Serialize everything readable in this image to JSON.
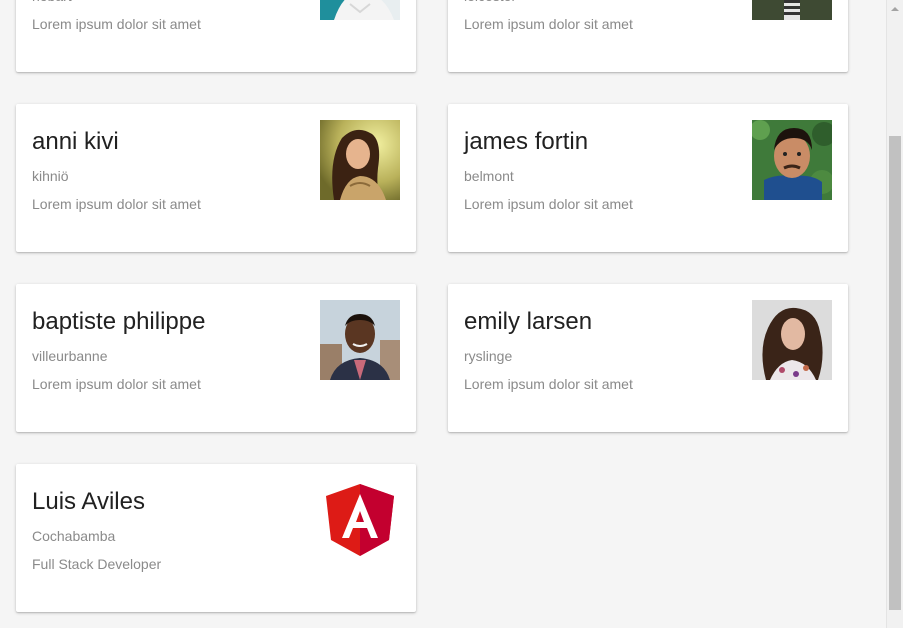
{
  "cards": [
    {
      "name": "",
      "city": "hobart",
      "description": "Lorem ipsum dolor sit amet",
      "photo": "person-photo"
    },
    {
      "name": "",
      "city": "leicester",
      "description": "Lorem ipsum dolor sit amet",
      "photo": "person-photo"
    },
    {
      "name": "anni kivi",
      "city": "kihniö",
      "description": "Lorem ipsum dolor sit amet",
      "photo": "person-photo"
    },
    {
      "name": "james fortin",
      "city": "belmont",
      "description": "Lorem ipsum dolor sit amet",
      "photo": "person-photo"
    },
    {
      "name": "baptiste philippe",
      "city": "villeurbanne",
      "description": "Lorem ipsum dolor sit amet",
      "photo": "person-photo"
    },
    {
      "name": "emily larsen",
      "city": "ryslinge",
      "description": "Lorem ipsum dolor sit amet",
      "photo": "person-photo"
    },
    {
      "name": "Luis Aviles",
      "city": "Cochabamba",
      "description": "Full Stack Developer",
      "photo": "angular-logo"
    }
  ],
  "colors": {
    "background": "#f5f5f5",
    "card": "#ffffff",
    "name_text": "#212121",
    "secondary_text": "#8a8a8a",
    "angular_red": "#dd1b16",
    "angular_dark_red": "#c3002f"
  }
}
